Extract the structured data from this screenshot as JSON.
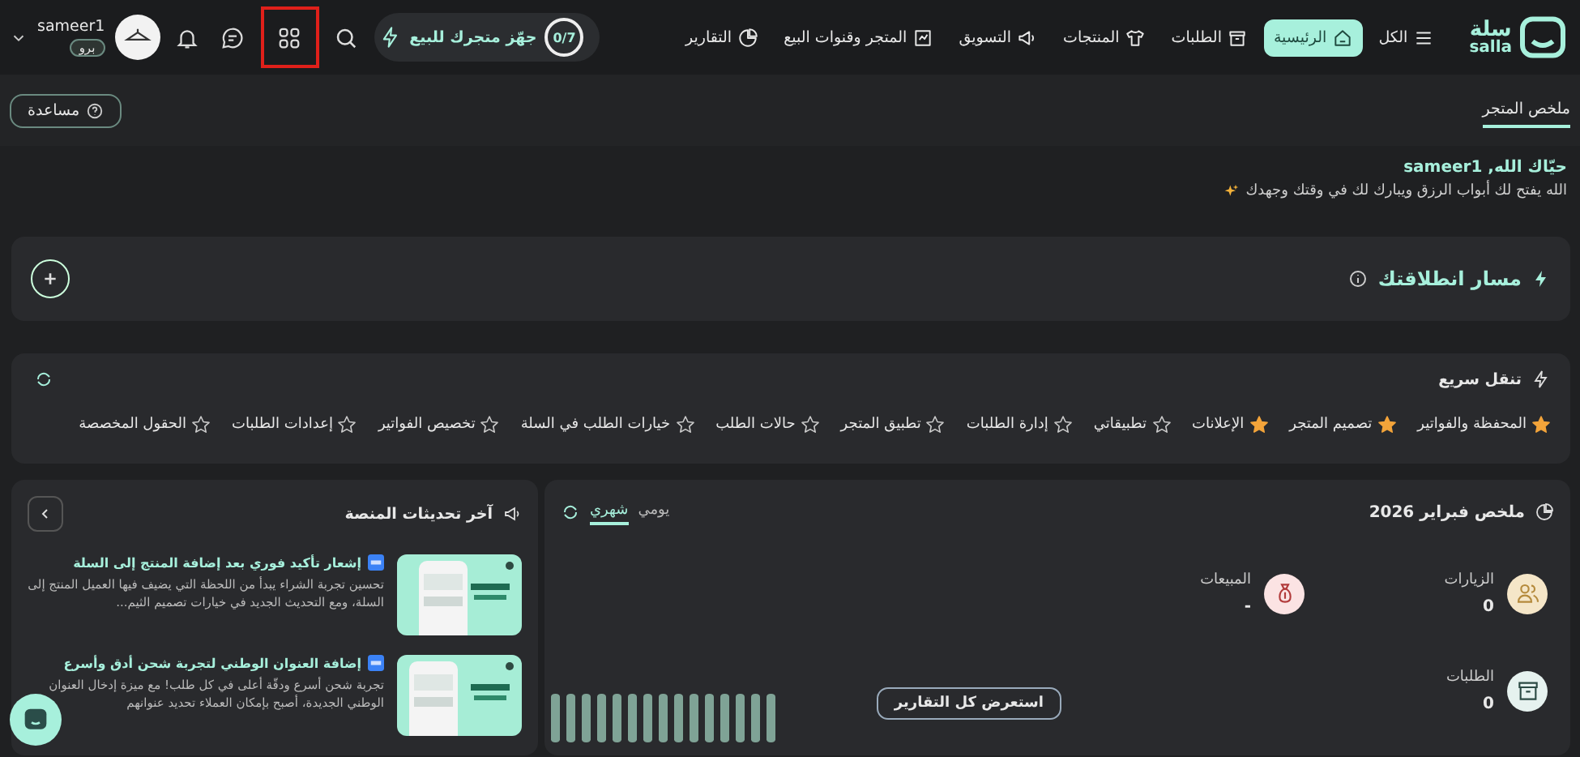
{
  "brand": {
    "name": "سلة",
    "latin": "salla"
  },
  "nav": [
    {
      "label": "الكل",
      "selected": false
    },
    {
      "label": "الرئيسية",
      "selected": true
    },
    {
      "label": "الطلبات",
      "selected": false
    },
    {
      "label": "المنتجات",
      "selected": false
    },
    {
      "label": "التسويق",
      "selected": false
    },
    {
      "label": "المتجر وقنوات البيع",
      "selected": false
    },
    {
      "label": "التقارير",
      "selected": false
    }
  ],
  "setup_pill": {
    "progress": "0/7",
    "label": "جهّز متجرك للبيع"
  },
  "user": {
    "name": "sameer1",
    "plan": "برو"
  },
  "breadcrumb": [
    {
      "label": "ملخص المتجر",
      "selected": true
    }
  ],
  "help_button": "مساعدة",
  "greeting": {
    "title": "حيّاك الله, sameer1",
    "subtitle": "الله يفتح لك أبواب الرزق ويبارك لك في وقتك وجهدك"
  },
  "launch_card": {
    "title": "مسار انطلاقتك"
  },
  "quick_nav": {
    "title": "تنقل سريع",
    "items": [
      {
        "label": "المحفظة والفواتير",
        "favorite": true
      },
      {
        "label": "تصميم المتجر",
        "favorite": true
      },
      {
        "label": "الإعلانات",
        "favorite": true
      },
      {
        "label": "تطبيقاتي",
        "favorite": false
      },
      {
        "label": "إدارة الطلبات",
        "favorite": false
      },
      {
        "label": "تطبيق المتجر",
        "favorite": false
      },
      {
        "label": "حالات الطلب",
        "favorite": false
      },
      {
        "label": "خيارات الطلب في السلة",
        "favorite": false
      },
      {
        "label": "تخصيص الفواتير",
        "favorite": false
      },
      {
        "label": "إعدادات الطلبات",
        "favorite": false
      },
      {
        "label": "الحقول المخصصة",
        "favorite": false
      }
    ]
  },
  "updates": {
    "title": "آخر تحديثات المنصة",
    "items": [
      {
        "title": "إشعار تأكيد فوري بعد إضافة المنتج إلى السلة",
        "body": "تحسين تجربة الشراء يبدأ من اللحظة التي يضيف فيها العميل المنتج إلى السلة، ومع التحديث الجديد في خيارات تصميم الثيم...",
        "is_new": true
      },
      {
        "title": "إضافة العنوان الوطني لتجربة شحن أدق وأسرع",
        "body": "تجربة شحن أسرع ودقّة أعلى في كل طلب! مع ميزة إدخال العنوان الوطني الجديدة، أصبح بإمكان العملاء تحديد عنوانهم",
        "is_new": true
      }
    ]
  },
  "summary": {
    "title": "ملخص فبراير 2026",
    "tabs": [
      {
        "label": "يومي",
        "selected": false
      },
      {
        "label": "شهري",
        "selected": true
      }
    ],
    "stats": [
      {
        "kind": "visits",
        "label": "الزيارات",
        "value": "0"
      },
      {
        "kind": "sales",
        "label": "المبيعات",
        "value": "-"
      },
      {
        "kind": "orders",
        "label": "الطلبات",
        "value": "0"
      }
    ],
    "reports_button": "استعرض كل التقارير"
  }
}
